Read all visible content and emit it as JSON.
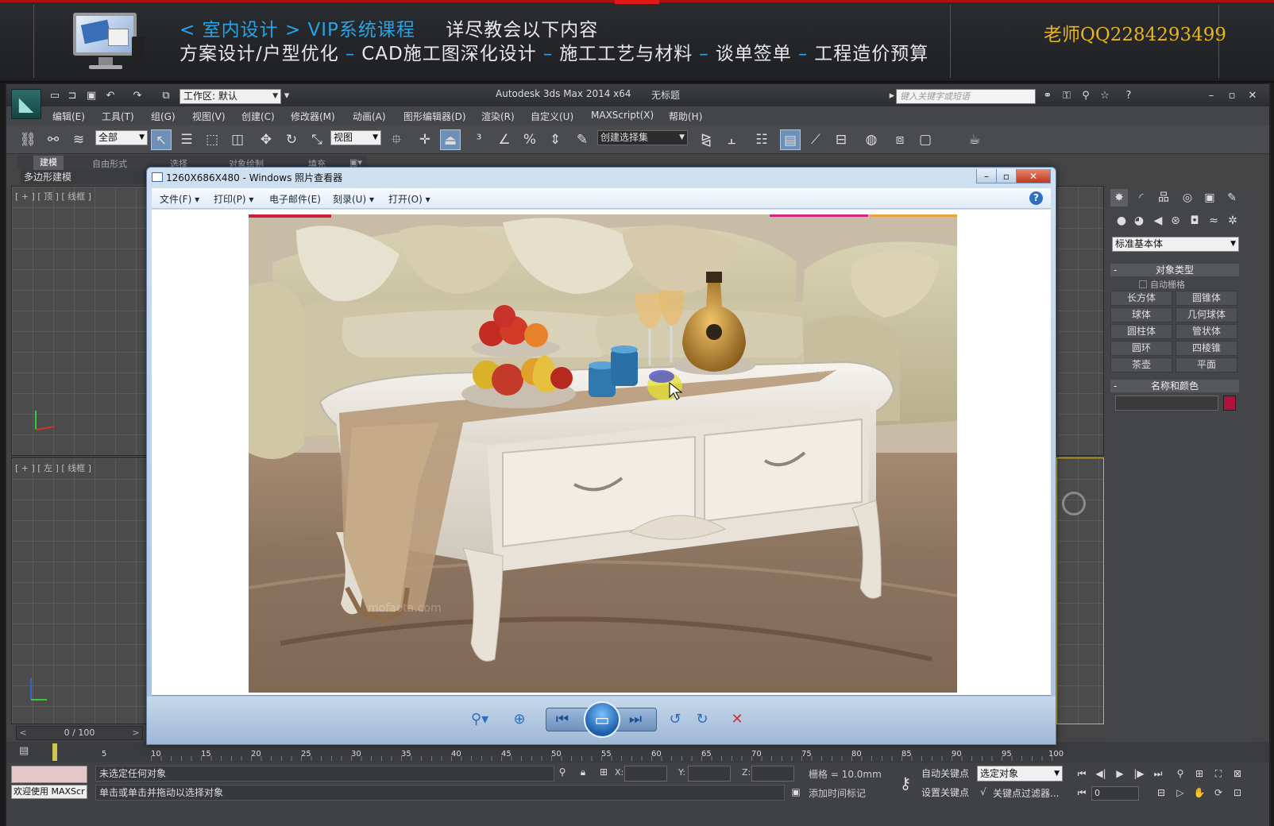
{
  "banner": {
    "prefix1": "< ",
    "crumb1": "室内设计",
    "prefix2": " > ",
    "crumb2": "VIP系统课程",
    "tagline": "详尽教会以下内容",
    "topics": [
      "方案设计/户型优化",
      "CAD施工图深化设计",
      "施工工艺与材料",
      "谈单签单",
      "工程造价预算"
    ],
    "topic_sep": "–",
    "teacher_qq": "老师QQ2284293499"
  },
  "max": {
    "workspace": "工作区: 默认",
    "title": "Autodesk 3ds Max  2014 x64",
    "untitled": "无标题",
    "search_placeholder": "键入关键字或短语",
    "menu": [
      "编辑(E)",
      "工具(T)",
      "组(G)",
      "视图(V)",
      "创建(C)",
      "修改器(M)",
      "动画(A)",
      "图形编辑器(D)",
      "渲染(R)",
      "自定义(U)",
      "MAXScript(X)",
      "帮助(H)"
    ],
    "selection_filter": "全部",
    "ref_coord": "视图",
    "named_selection": "创建选择集",
    "ribbon_tabs": [
      "建模",
      "自由形式",
      "选择",
      "对象绘制",
      "填充"
    ],
    "subtab": "多边形建模",
    "viewport_labels": {
      "top": "[ + ] [ 顶 ] [ 线框 ]",
      "left": "[ + ] [ 左 ] [ 线框 ]"
    },
    "time_slider": "0 / 100",
    "track_ticks": [
      "10",
      "15",
      "20",
      "25",
      "30",
      "35",
      "40",
      "45",
      "50",
      "55",
      "60",
      "65",
      "70",
      "75",
      "80",
      "85",
      "90",
      "95",
      "100"
    ],
    "track_first": "5",
    "command_panel": {
      "category": "标准基本体",
      "rollout_object_type": "对象类型",
      "autogrid": "自动栅格",
      "primitives": [
        "长方体",
        "圆锥体",
        "球体",
        "几何球体",
        "圆柱体",
        "管状体",
        "圆环",
        "四棱锥",
        "茶壶",
        "平面"
      ],
      "rollout_name_color": "名称和颜色",
      "object_color": "#b0123c"
    },
    "status": {
      "welcome": "欢迎使用 MAXScr",
      "line1": "未选定任何对象",
      "line2": "单击或单击并拖动以选择对象",
      "x_label": "X:",
      "y_label": "Y:",
      "z_label": "Z:",
      "grid": "栅格 = 10.0mm",
      "add_time_tag": "添加时间标记",
      "auto_key": "自动关键点",
      "set_key": "设置关键点",
      "selected": "选定对象",
      "key_filters": "关键点过滤器...",
      "frame": "0"
    }
  },
  "viewer": {
    "title": "1260X686X480 - Windows 照片查看器",
    "menu": [
      "文件(F)",
      "打印(P)",
      "电子邮件(E)",
      "刻录(U)",
      "打开(O)"
    ],
    "menu_has_arrow": [
      true,
      true,
      false,
      true,
      true
    ],
    "image_description_icon": "coffee-table-photo"
  },
  "colors": {
    "accent_blue": "#29a3e6",
    "qq_gold": "#e7b61c",
    "banner_red": "#b01010"
  }
}
